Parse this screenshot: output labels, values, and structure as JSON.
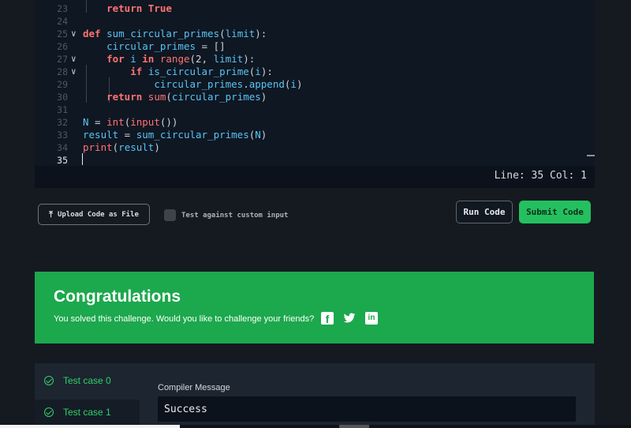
{
  "editor": {
    "lines": [
      {
        "num": "23",
        "fold": "",
        "indent": "    ",
        "tokens": [
          {
            "t": "return",
            "c": "kw"
          },
          {
            "t": " "
          },
          {
            "t": "True",
            "c": "kw"
          }
        ]
      },
      {
        "num": "24",
        "fold": "",
        "indent": "",
        "tokens": []
      },
      {
        "num": "25",
        "fold": "v",
        "indent": "",
        "tokens": [
          {
            "t": "def",
            "c": "kw"
          },
          {
            "t": " "
          },
          {
            "t": "sum_circular_primes",
            "c": "id"
          },
          {
            "t": "("
          },
          {
            "t": "limit",
            "c": "id"
          },
          {
            "t": "):"
          }
        ]
      },
      {
        "num": "26",
        "fold": "",
        "indent": "    ",
        "tokens": [
          {
            "t": "circular_primes",
            "c": "id"
          },
          {
            "t": " = []"
          }
        ]
      },
      {
        "num": "27",
        "fold": "v",
        "indent": "    ",
        "tokens": [
          {
            "t": "for",
            "c": "kw"
          },
          {
            "t": " "
          },
          {
            "t": "i",
            "c": "id"
          },
          {
            "t": " "
          },
          {
            "t": "in",
            "c": "kw"
          },
          {
            "t": " "
          },
          {
            "t": "range",
            "c": "builtin"
          },
          {
            "t": "(2, "
          },
          {
            "t": "limit",
            "c": "id"
          },
          {
            "t": "):"
          }
        ]
      },
      {
        "num": "28",
        "fold": "v",
        "indent": "        ",
        "tokens": [
          {
            "t": "if",
            "c": "kw"
          },
          {
            "t": " "
          },
          {
            "t": "is_circular_prime",
            "c": "id"
          },
          {
            "t": "("
          },
          {
            "t": "i",
            "c": "id"
          },
          {
            "t": "):"
          }
        ]
      },
      {
        "num": "29",
        "fold": "",
        "indent": "            ",
        "tokens": [
          {
            "t": "circular_primes",
            "c": "id"
          },
          {
            "t": "."
          },
          {
            "t": "append",
            "c": "id"
          },
          {
            "t": "("
          },
          {
            "t": "i",
            "c": "id"
          },
          {
            "t": ")"
          }
        ]
      },
      {
        "num": "30",
        "fold": "",
        "indent": "    ",
        "tokens": [
          {
            "t": "return",
            "c": "kw"
          },
          {
            "t": " "
          },
          {
            "t": "sum",
            "c": "builtin"
          },
          {
            "t": "("
          },
          {
            "t": "circular_primes",
            "c": "id"
          },
          {
            "t": ")"
          }
        ]
      },
      {
        "num": "31",
        "fold": "",
        "indent": "",
        "tokens": []
      },
      {
        "num": "32",
        "fold": "",
        "indent": "",
        "tokens": [
          {
            "t": "N",
            "c": "id"
          },
          {
            "t": " = "
          },
          {
            "t": "int",
            "c": "builtin"
          },
          {
            "t": "("
          },
          {
            "t": "input",
            "c": "builtin"
          },
          {
            "t": "())"
          }
        ]
      },
      {
        "num": "33",
        "fold": "",
        "indent": "",
        "tokens": [
          {
            "t": "result",
            "c": "id"
          },
          {
            "t": " = "
          },
          {
            "t": "sum_circular_primes",
            "c": "id"
          },
          {
            "t": "("
          },
          {
            "t": "N",
            "c": "id"
          },
          {
            "t": ")"
          }
        ]
      },
      {
        "num": "34",
        "fold": "",
        "indent": "",
        "tokens": [
          {
            "t": "print",
            "c": "builtin"
          },
          {
            "t": "("
          },
          {
            "t": "result",
            "c": "id"
          },
          {
            "t": ")"
          }
        ]
      },
      {
        "num": "35",
        "fold": "",
        "indent": "",
        "tokens": [],
        "active": true
      }
    ],
    "status": "Line: 35 Col: 1"
  },
  "actions": {
    "upload_label": "Upload Code as File",
    "custom_input_label": "Test against custom input",
    "run_label": "Run Code",
    "submit_label": "Submit Code"
  },
  "congrats": {
    "title": "Congratulations",
    "message": "You solved this challenge. Would you like to challenge your friends?"
  },
  "results": {
    "test_cases": [
      "Test case 0",
      "Test case 1"
    ],
    "compiler_label": "Compiler Message",
    "compiler_message": "Success"
  },
  "colors": {
    "accent_green": "#1ca84c",
    "submit_green": "#24c05f",
    "keyword_red": "#ff7373",
    "identifier_blue": "#58c4f5"
  }
}
